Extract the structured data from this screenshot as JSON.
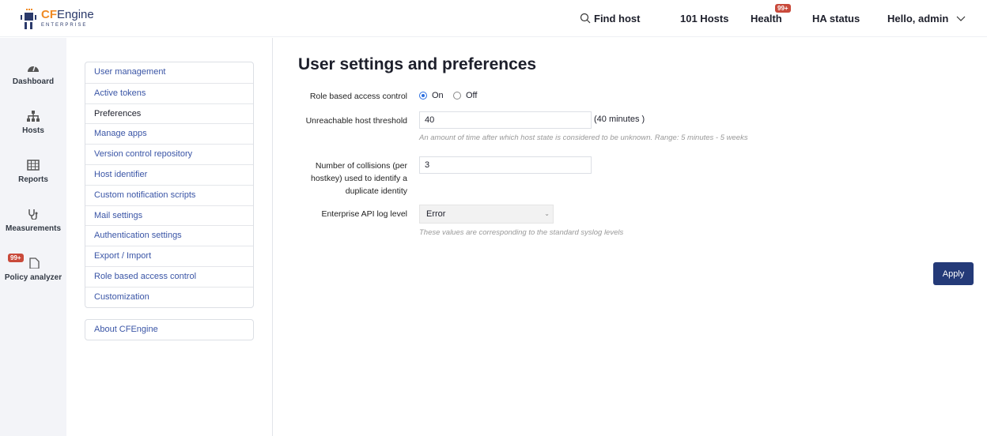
{
  "header": {
    "logo_brand_cf": "CF",
    "logo_brand_rest": "Engine",
    "logo_sub": "ENTERPRISE",
    "find_host": "Find host",
    "hosts": "101 Hosts",
    "health": "Health",
    "health_badge": "99+",
    "ha_status": "HA status",
    "user": "Hello, admin"
  },
  "leftnav": [
    {
      "label": "Dashboard",
      "icon": "gauge-icon"
    },
    {
      "label": "Hosts",
      "icon": "sitemap-icon"
    },
    {
      "label": "Reports",
      "icon": "table-icon"
    },
    {
      "label": "Measurements",
      "icon": "stethoscope-icon"
    },
    {
      "label": "Policy analyzer",
      "icon": "file-icon",
      "badge": "99+"
    }
  ],
  "menu": {
    "items": [
      "User management",
      "Active tokens",
      "Preferences",
      "Manage apps",
      "Version control repository",
      "Host identifier",
      "Custom notification scripts",
      "Mail settings",
      "Authentication settings",
      "Export / Import",
      "Role based access control",
      "Customization"
    ],
    "active": "Preferences",
    "about": "About CFEngine"
  },
  "main": {
    "title": "User settings and preferences",
    "rbac": {
      "label": "Role based access control",
      "on": "On",
      "off": "Off",
      "value": "On"
    },
    "threshold": {
      "label": "Unreachable host threshold",
      "value": "40",
      "suffix": "(40 minutes )",
      "help": "An amount of time after which host state is considered to be unknown. Range: 5 minutes - 5 weeks"
    },
    "collisions": {
      "label": "Number of collisions (per hostkey) used to identify a duplicate identity",
      "value": "3"
    },
    "loglevel": {
      "label": "Enterprise API log level",
      "value": "Error",
      "help": "These values are corresponding to the standard syslog levels"
    },
    "apply": "Apply"
  },
  "colors": {
    "accent": "#243a78",
    "link": "#3a55a6",
    "badge": "#c94a3b",
    "brand_orange": "#f08a24"
  }
}
